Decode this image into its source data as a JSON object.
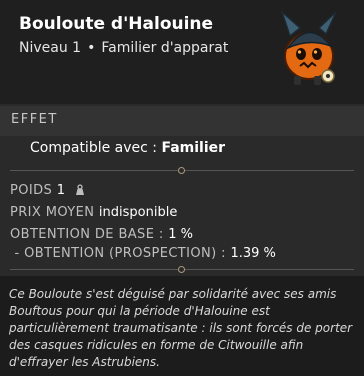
{
  "header": {
    "title": "Bouloute d'Halouine",
    "level": "Niveau 1",
    "separator": "•",
    "category": "Familier d'apparat"
  },
  "effect": {
    "section_label": "EFFET",
    "compatible_label": "Compatible avec :",
    "compatible_value": "Familier"
  },
  "stats": {
    "weight_label": "POIDS",
    "weight_value": "1",
    "price_label": "PRIX MOYEN",
    "price_value": "indisponible",
    "base_label": "OBTENTION DE BASE :",
    "base_value": "1 %",
    "prospect_label": " - OBTENTION (PROSPECTION) :",
    "prospect_value": "1.39 %"
  },
  "description": "Ce Bouloute s'est déguisé par solidarité avec ses amis Bouftous pour qui la période d'Halouine est particulièrement traumatisante : ils sont forcés de porter des casques ridicules en forme de Citwouille afin d'effrayer les Astrubiens.",
  "icons": [
    "pet-portrait-icon",
    "weight-icon"
  ],
  "colors": {
    "header_bg": "#1f1f1f",
    "panel_bg": "#2a2a2a",
    "section_bg": "#333333",
    "description_bg": "#1c1c1c"
  }
}
